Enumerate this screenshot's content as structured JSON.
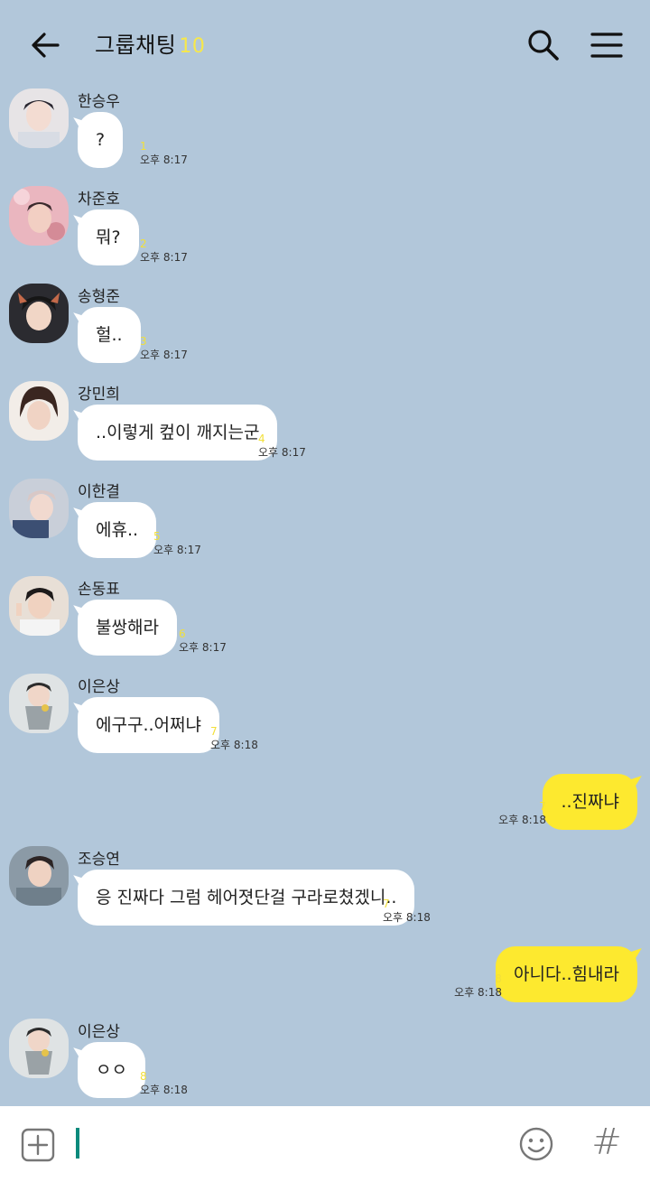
{
  "header": {
    "title": "그룹채팅",
    "member_count": "10",
    "back_icon": "arrow-left-icon",
    "search_icon": "search-icon",
    "menu_icon": "hamburger-menu-icon"
  },
  "messages": [
    {
      "sender": "한승우",
      "text": "?",
      "unread": "1",
      "time": "오후 8:17"
    },
    {
      "sender": "차준호",
      "text": "뭐?",
      "unread": "2",
      "time": "오후 8:17"
    },
    {
      "sender": "송형준",
      "text": "헐..",
      "unread": "3",
      "time": "오후 8:17"
    },
    {
      "sender": "강민희",
      "text": "..이렇게 컾이 깨지는군",
      "unread": "4",
      "time": "오후 8:17"
    },
    {
      "sender": "이한결",
      "text": "에휴..",
      "unread": "5",
      "time": "오후 8:17"
    },
    {
      "sender": "손동표",
      "text": "불쌍해라",
      "unread": "6",
      "time": "오후 8:17"
    },
    {
      "sender": "이은상",
      "text": "에구구..어쩌냐",
      "unread": "7",
      "time": "오후 8:18"
    },
    {
      "text": "..진짜냐",
      "unread": "7",
      "time": "오후 8:18",
      "mine": true
    },
    {
      "sender": "조승연",
      "text": "응 진짜다 그럼 헤어졋단걸 구라로쳤겠니..",
      "unread": "7",
      "time": "오후 8:18"
    },
    {
      "text": "아니다..힘내라",
      "unread": "8",
      "time": "오후 8:18",
      "mine": true
    },
    {
      "sender": "이은상",
      "text": "ㅇㅇ",
      "unread": "8",
      "time": "오후 8:18"
    }
  ],
  "input": {
    "plus_icon": "plus-square-icon",
    "emoji_icon": "smiley-icon",
    "hash_label": "#"
  },
  "colors": {
    "background": "#b2c7da",
    "my_bubble": "#fde92f",
    "other_bubble": "#ffffff",
    "unread_count": "#f2e03a",
    "cursor": "#0b8a7c"
  }
}
